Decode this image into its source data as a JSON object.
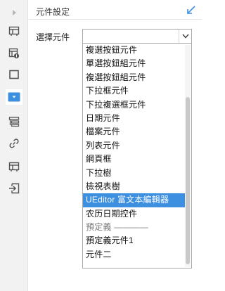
{
  "panel": {
    "title": "元件設定",
    "field_label": "選擇元件"
  },
  "select": {
    "value": ""
  },
  "sidebar": {
    "icons": [
      "expand-arrow-icon",
      "table-icon",
      "table-settings-icon",
      "rectangle-icon",
      "dropdown-icon",
      "list-stack-icon",
      "link-icon",
      "table-icon",
      "import-icon"
    ]
  },
  "dropdown": {
    "options": [
      "複選按鈕元件",
      "單選按鈕組元件",
      "複選按鈕組元件",
      "下拉框元件",
      "下拉複選框元件",
      "日期元件",
      "檔案元件",
      "列表元件",
      "網頁框",
      "下拉樹",
      "檢視表樹",
      "UEditor 富文本編輯器",
      "农历日期控件",
      "預定義 ————",
      "預定義元件1",
      "元件二"
    ],
    "selected_index": 11,
    "group_header_index": 13
  },
  "colors": {
    "accent": "#3d8fe0",
    "sidebar_bg": "#f2f2f2",
    "collapse_icon": "#3d8fe0"
  }
}
